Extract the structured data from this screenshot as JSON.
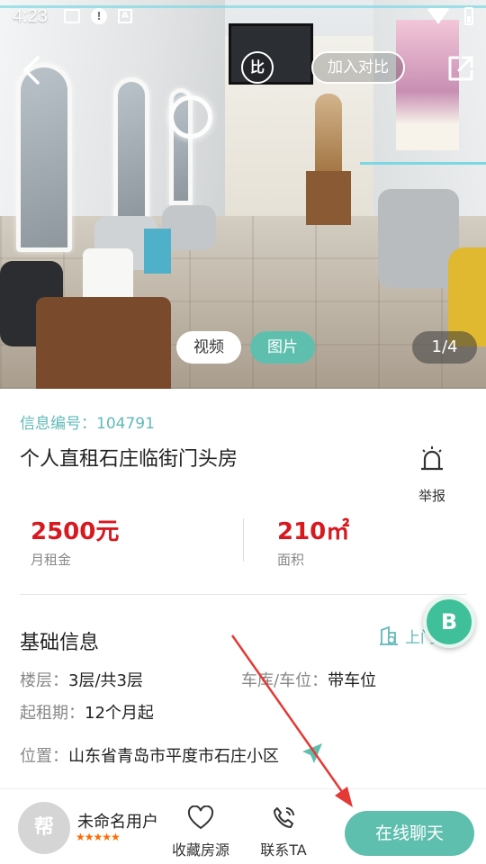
{
  "status_bar": {
    "time": "4:23"
  },
  "header": {
    "compare_icon_label": "比",
    "add_compare": "加入对比"
  },
  "media": {
    "tabs": [
      "视频",
      "图片"
    ],
    "active_tab": "图片",
    "counter": "1/4"
  },
  "listing": {
    "info_id": "信息编号：104791",
    "title": "个人直租石庄临街门头房",
    "report": "举报",
    "price": {
      "value": "2500元",
      "label": "月租金"
    },
    "area": {
      "value": "210㎡",
      "label": "面积"
    }
  },
  "basic_info": {
    "title": "基础信息",
    "upload_link": "上门",
    "floor": {
      "key": "楼层：",
      "value": "3层/共3层"
    },
    "garage": {
      "key": "车库/车位：",
      "value": "带车位"
    },
    "lease": {
      "key": "起租期：",
      "value": "12个月起"
    },
    "location": {
      "key": "位置：",
      "value": "山东省青岛市平度市石庄小区"
    }
  },
  "bottom_bar": {
    "avatar_text": "帮",
    "user_name": "未命名用户",
    "rating_stars": 5,
    "stars": "★★★★★",
    "favorite": "收藏房源",
    "contact": "联系TA",
    "chat": "在线聊天"
  },
  "colors": {
    "accent_teal": "#5fbfae",
    "price_red": "#d71920",
    "link_teal": "#5fb9b8",
    "annotation_red": "#e53935"
  }
}
